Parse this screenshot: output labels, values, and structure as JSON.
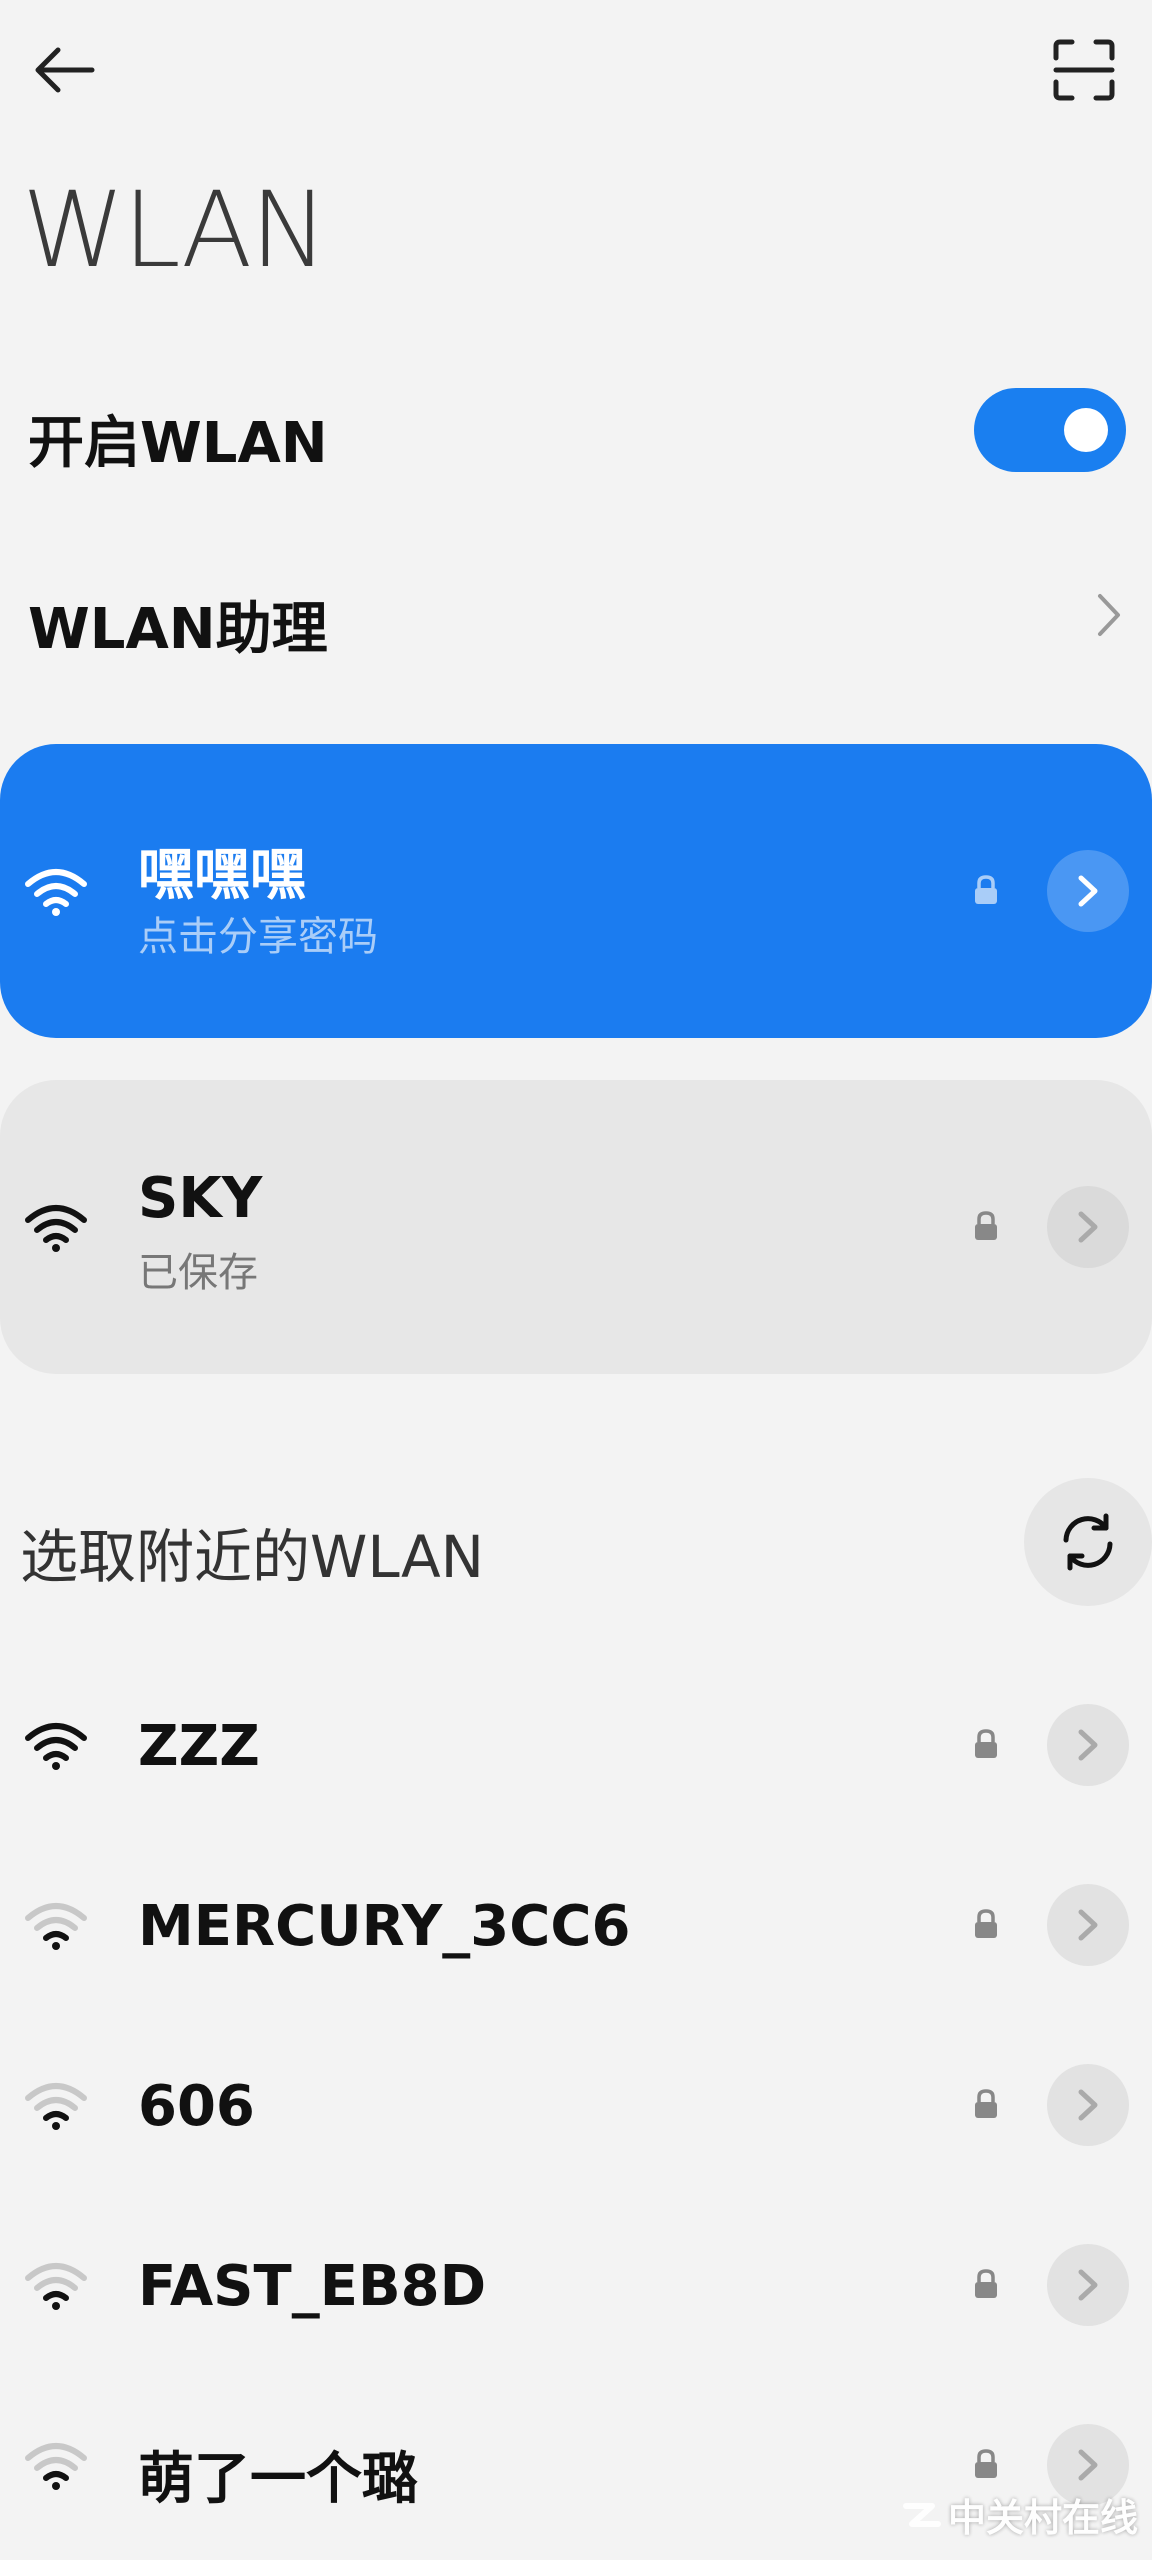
{
  "page": {
    "title": "WLAN"
  },
  "toggle_row": {
    "label": "开启WLAN",
    "state": "on"
  },
  "assistant_row": {
    "label": "WLAN助理"
  },
  "connected_network": {
    "name": "嘿嘿嘿",
    "sub": "点击分享密码",
    "locked": true
  },
  "saved_network": {
    "name": "SKY",
    "sub": "已保存",
    "locked": true
  },
  "nearby_section": {
    "title": "选取附近的WLAN"
  },
  "nearby_networks": [
    {
      "name": "ZZZ",
      "signal": "full",
      "locked": true
    },
    {
      "name": "MERCURY_3CC6",
      "signal": "weak",
      "locked": true
    },
    {
      "name": "606",
      "signal": "weak",
      "locked": true
    },
    {
      "name": "FAST_EB8D",
      "signal": "weak",
      "locked": true
    },
    {
      "name": "萌了一个璐",
      "signal": "weak",
      "locked": true
    }
  ],
  "watermark": {
    "text": "中关村在线"
  },
  "icons": {
    "back": "back-arrow-icon",
    "scan": "scan-icon",
    "wifi": "wifi-icon",
    "lock": "lock-icon",
    "chevron": "chevron-right-icon",
    "refresh": "refresh-icon"
  },
  "colors": {
    "accent": "#1b7cf0",
    "background": "#f3f3f3",
    "saved_card": "#e7e7e7"
  }
}
